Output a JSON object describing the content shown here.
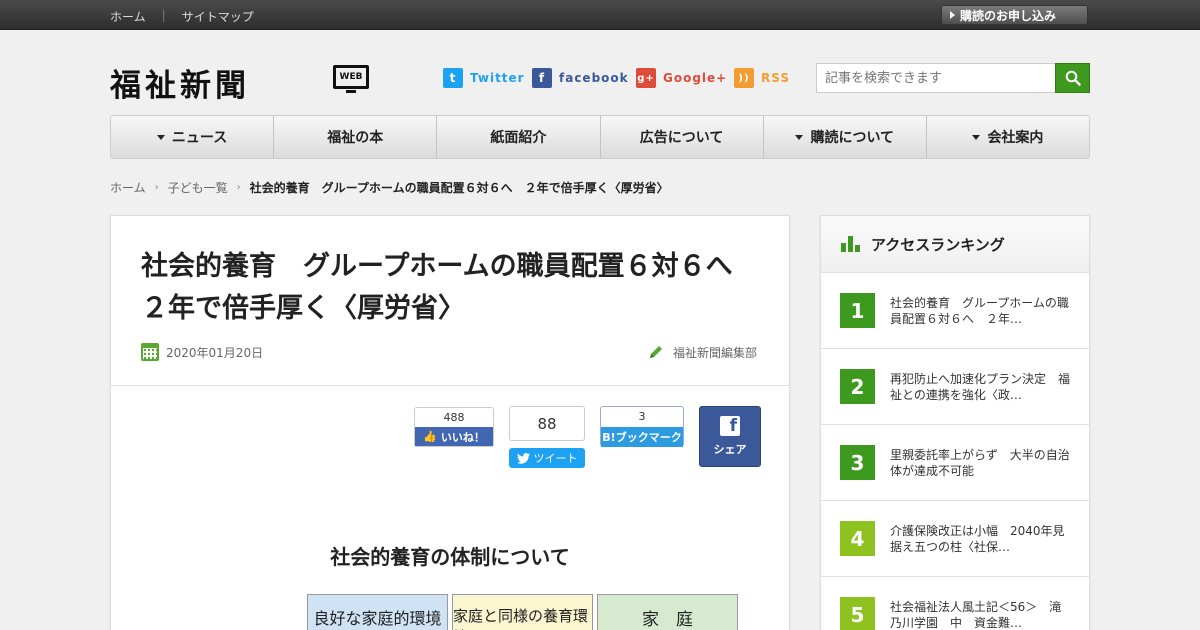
{
  "topbar": {
    "links": [
      "ホーム",
      "サイトマップ"
    ],
    "subscribe_label": "購読のお申し込み"
  },
  "header": {
    "logo_text": "福祉新聞",
    "logo_badge": "WEB",
    "social": [
      {
        "label": "Twitter",
        "icon": "twitter-icon",
        "glyph": "t",
        "color": "#1da1f2"
      },
      {
        "label": "facebook",
        "icon": "facebook-icon",
        "glyph": "f",
        "color": "#3b5998"
      },
      {
        "label": "Google+",
        "icon": "google-plus-icon",
        "glyph": "g+",
        "color": "#dd4b39"
      },
      {
        "label": "RSS",
        "icon": "rss-icon",
        "glyph": "))",
        "color": "#f39c32"
      }
    ],
    "search_placeholder": "記事を検索できます"
  },
  "nav": {
    "items": [
      {
        "label": "ニュース",
        "dropdown": true
      },
      {
        "label": "福祉の本",
        "dropdown": false
      },
      {
        "label": "紙面紹介",
        "dropdown": false
      },
      {
        "label": "広告について",
        "dropdown": false
      },
      {
        "label": "購読について",
        "dropdown": true
      },
      {
        "label": "会社案内",
        "dropdown": true
      }
    ]
  },
  "breadcrumb": {
    "items": [
      "ホーム",
      "子ども一覧"
    ],
    "current": "社会的養育　グループホームの職員配置６対６へ　２年で倍手厚く〈厚労省〉"
  },
  "article": {
    "title": "社会的養育　グループホームの職員配置６対６へ　２年で倍手厚く〈厚労省〉",
    "date": "2020年01月20日",
    "author": "福祉新聞編集部",
    "share": {
      "fb_like_count": "488",
      "fb_like_label": "いいね！",
      "tweet_count": "88",
      "tweet_label": "ツイート",
      "hatena_count": "3",
      "hatena_label": "B!ブックマーク",
      "fb_share_label": "シェア"
    },
    "figure": {
      "title": "社会的養育の体制について",
      "boxes": [
        {
          "label": "良好な家庭的環境",
          "color": "#cfe3f5"
        },
        {
          "label": "家庭と同様の養育環境",
          "color": "#fbf6cf"
        },
        {
          "label": "家　庭",
          "color": "#d6ead0"
        }
      ]
    }
  },
  "sidebar": {
    "title": "アクセスランキング",
    "ranking": [
      {
        "rank": "1",
        "text": "社会的養育　グループホームの職員配置６対６へ　２年…",
        "color": "#3d9a1e"
      },
      {
        "rank": "2",
        "text": "再犯防止へ加速化プラン決定　福祉との連携を強化〈政…",
        "color": "#3d9a1e"
      },
      {
        "rank": "3",
        "text": "里親委託率上がらず　大半の自治体が達成不可能",
        "color": "#3d9a1e"
      },
      {
        "rank": "4",
        "text": "介護保険改正は小幅　2040年見据え五つの柱〈社保…",
        "color": "#8dc21f"
      },
      {
        "rank": "5",
        "text": "社会福祉法人風土記＜56＞　滝乃川学園　中　資金難…",
        "color": "#8dc21f"
      }
    ]
  }
}
